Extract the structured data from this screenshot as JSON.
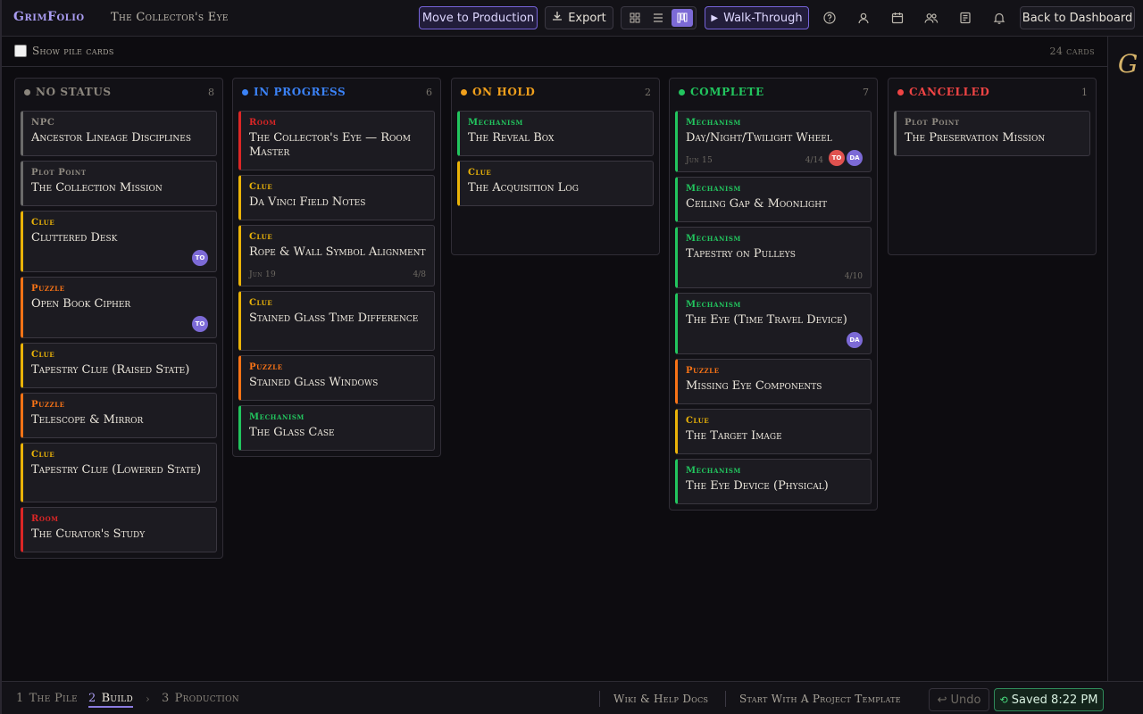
{
  "header": {
    "brand": "GrimFolio",
    "project_title": "The Collector's Eye",
    "move_to_production": "Move to Production",
    "export": "Export",
    "walkthrough": "Walk-Through",
    "back_to_dashboard": "Back to Dashboard",
    "active_view": "board"
  },
  "filter": {
    "show_pile_cards": "Show pile cards",
    "card_count": "24 cards"
  },
  "colors": {
    "accent": "#7c6ad6",
    "no_status": "#8a857c",
    "in_progress": "#3b82f6",
    "on_hold": "#f0a01c",
    "complete": "#22c55e",
    "cancelled": "#ef4444",
    "npc": "#6b6b6b",
    "plot_point": "#6b6b6b",
    "clue": "#eab308",
    "puzzle": "#f97316",
    "room": "#dc2626",
    "mechanism": "#22c55e"
  },
  "columns": [
    {
      "title": "NO STATUS",
      "count": "8",
      "color": "#8a857c",
      "cards": [
        {
          "type": "npc",
          "type_label": "NPC",
          "title": "Ancestor Lineage Disciplines"
        },
        {
          "type": "plot_point",
          "type_label": "Plot Point",
          "title": "The Collection Mission"
        },
        {
          "type": "clue",
          "type_label": "Clue",
          "title": "Cluttered Desk",
          "avatars": [
            {
              "initials": "TO",
              "color": "#7c6ad6"
            }
          ]
        },
        {
          "type": "puzzle",
          "type_label": "Puzzle",
          "title": "Open Book Cipher",
          "avatars": [
            {
              "initials": "TO",
              "color": "#7c6ad6"
            }
          ]
        },
        {
          "type": "clue",
          "type_label": "Clue",
          "title": "Tapestry Clue (Raised State)"
        },
        {
          "type": "puzzle",
          "type_label": "Puzzle",
          "title": "Telescope & Mirror"
        },
        {
          "type": "clue",
          "type_label": "Clue",
          "title": "Tapestry Clue (Lowered State)"
        },
        {
          "type": "room",
          "type_label": "Room",
          "title": "The Curator's Study"
        }
      ]
    },
    {
      "title": "IN PROGRESS",
      "count": "6",
      "color": "#3b82f6",
      "cards": [
        {
          "type": "room",
          "type_label": "Room",
          "title": "The Collector's Eye — Room Master"
        },
        {
          "type": "clue",
          "type_label": "Clue",
          "title": "Da Vinci Field Notes"
        },
        {
          "type": "clue",
          "type_label": "Clue",
          "title": "Rope & Wall Symbol Alignment",
          "date": "Jun 19",
          "progress": "4/8"
        },
        {
          "type": "clue",
          "type_label": "Clue",
          "title": "Stained Glass Time Difference"
        },
        {
          "type": "puzzle",
          "type_label": "Puzzle",
          "title": "Stained Glass Windows"
        },
        {
          "type": "mechanism",
          "type_label": "Mechanism",
          "title": "The Glass Case"
        }
      ]
    },
    {
      "title": "ON HOLD",
      "count": "2",
      "color": "#f0a01c",
      "cards": [
        {
          "type": "mechanism",
          "type_label": "Mechanism",
          "title": "The Reveal Box"
        },
        {
          "type": "clue",
          "type_label": "Clue",
          "title": "The Acquisition Log"
        }
      ]
    },
    {
      "title": "COMPLETE",
      "count": "7",
      "color": "#22c55e",
      "cards": [
        {
          "type": "mechanism",
          "type_label": "Mechanism",
          "title": "Day/Night/Twilight Wheel",
          "date": "Jun 15",
          "progress": "4/14",
          "avatars": [
            {
              "initials": "TO",
              "color": "#e0524f"
            },
            {
              "initials": "DA",
              "color": "#7c6ad6"
            }
          ]
        },
        {
          "type": "mechanism",
          "type_label": "Mechanism",
          "title": "Ceiling Gap & Moonlight"
        },
        {
          "type": "mechanism",
          "type_label": "Mechanism",
          "title": "Tapestry on Pulleys",
          "progress": "4/10"
        },
        {
          "type": "mechanism",
          "type_label": "Mechanism",
          "title": "The Eye (Time Travel Device)",
          "avatars": [
            {
              "initials": "DA",
              "color": "#7c6ad6"
            }
          ]
        },
        {
          "type": "puzzle",
          "type_label": "Puzzle",
          "title": "Missing Eye Components"
        },
        {
          "type": "clue",
          "type_label": "Clue",
          "title": "The Target Image"
        },
        {
          "type": "mechanism",
          "type_label": "Mechanism",
          "title": "The Eye Device (Physical)"
        }
      ]
    },
    {
      "title": "CANCELLED",
      "count": "1",
      "color": "#ef4444",
      "cards": [
        {
          "type": "plot_point",
          "type_label": "Plot Point",
          "title": "The Preservation Mission"
        }
      ]
    }
  ],
  "footer": {
    "steps": [
      {
        "num": "1",
        "label": "The Pile",
        "active": false
      },
      {
        "num": "2",
        "label": "Build",
        "active": true
      },
      {
        "num": "3",
        "label": "Production",
        "active": false
      }
    ],
    "wiki": "Wiki & Help Docs",
    "template": "Start With A Project Template",
    "undo": "Undo",
    "saved": "Saved 8:22 PM"
  }
}
